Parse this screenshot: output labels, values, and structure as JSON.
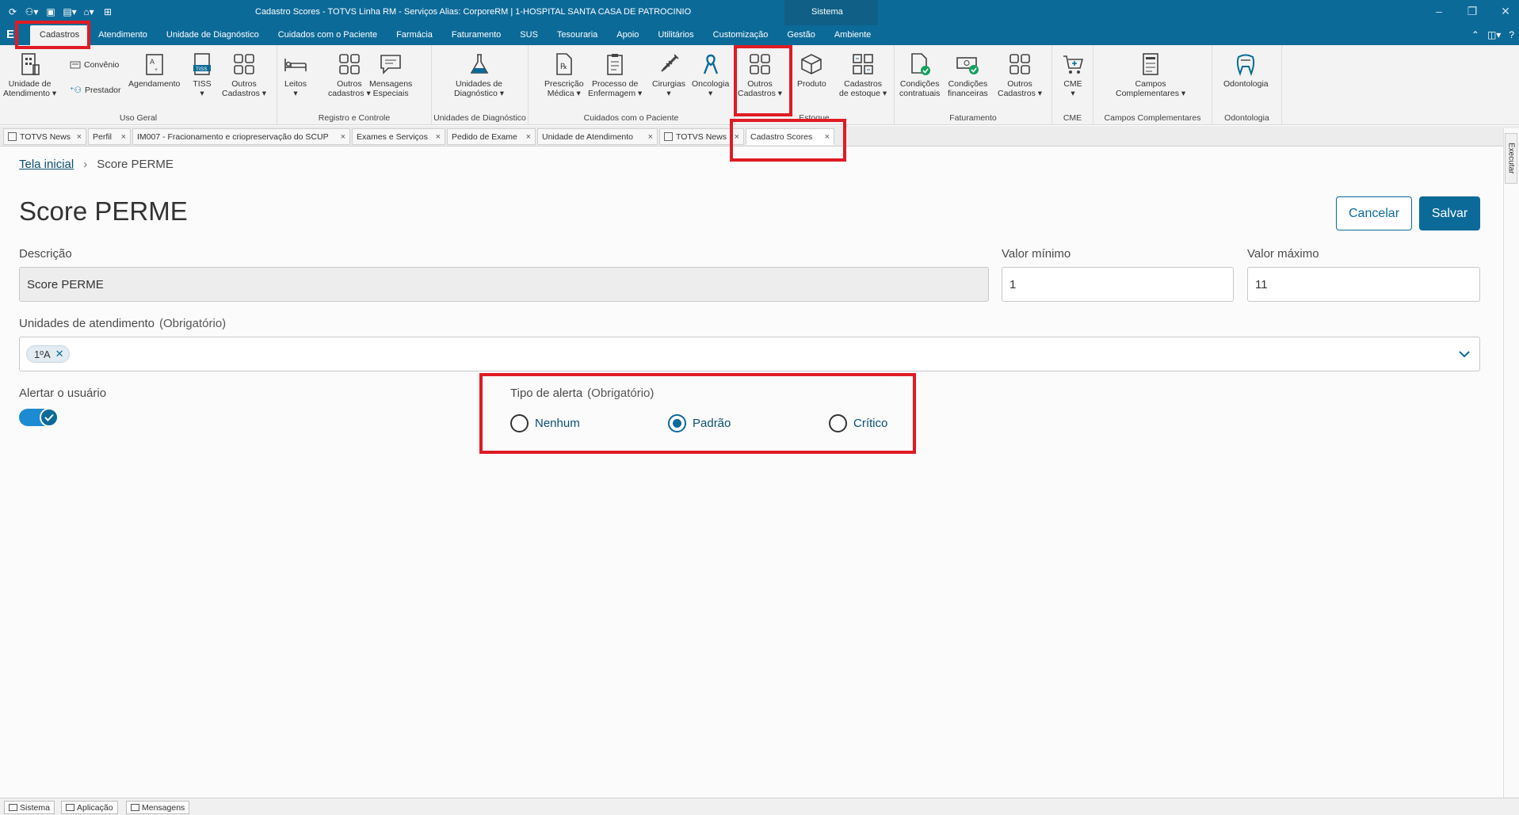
{
  "window": {
    "title": "Cadastro Scores - TOTVS Linha RM - Serviços  Alias: CorporeRM | 1-HOSPITAL SANTA CASA DE PATROCINIO",
    "sistema_tab": "Sistema"
  },
  "menu": {
    "logo": "E",
    "items": [
      "Cadastros",
      "Atendimento",
      "Unidade de Diagnóstico",
      "Cuidados com o Paciente",
      "Farmácia",
      "Faturamento",
      "SUS",
      "Tesouraria",
      "Apoio",
      "Utilitários",
      "Customização",
      "Gestão",
      "Ambiente"
    ],
    "active_index": 0
  },
  "ribbon": {
    "groups": {
      "uso_geral": "Uso Geral",
      "registro": "Registro e Controle",
      "unid_diag": "Unidades de Diagnóstico",
      "cuidados": "Cuidados com o Paciente",
      "estoque": "Estoque",
      "faturamento": "Faturamento",
      "cme": "CME",
      "campos": "Campos Complementares",
      "odonto": "Odontologia"
    },
    "buttons": {
      "unidade_atend_1": "Unidade de",
      "unidade_atend_2": "Atendimento",
      "convenio": "Convênio",
      "prestador": "Prestador",
      "agendamento": "Agendamento",
      "tiss": "TISS",
      "tiss_badge": "TISS",
      "outros_cad_1": "Outros",
      "outros_cad_2": "Cadastros",
      "leitos": "Leitos",
      "outros_cadastros_1": "Outros",
      "outros_cadastros_2": "cadastros",
      "mensagens_1": "Mensagens",
      "mensagens_2": "Especiais",
      "unidades_diag_1": "Unidades de",
      "unidades_diag_2": "Diagnóstico",
      "prescricao_1": "Prescrição",
      "prescricao_2": "Médica",
      "processo_1": "Processo de",
      "processo_2": "Enfermagem",
      "cirurgias": "Cirurgias",
      "oncologia": "Oncologia",
      "outros_cad3_1": "Outros",
      "outros_cad3_2": "Cadastros",
      "produto": "Produto",
      "cad_estoque_1": "Cadastros",
      "cad_estoque_2": "de estoque",
      "cond_contr_1": "Condições",
      "cond_contr_2": "contratuais",
      "cond_fin_1": "Condições",
      "cond_fin_2": "financeiras",
      "outros_cad4_1": "Outros",
      "outros_cad4_2": "Cadastros",
      "cme": "CME",
      "campos_1": "Campos",
      "campos_2": "Complementares",
      "odontologia": "Odontologia"
    }
  },
  "doc_tabs": [
    "TOTVS News",
    "Perfil",
    "IM007 - Fracionamento e criopreservação do SCUP",
    "Exames e Serviços",
    "Pedido de Exame",
    "Unidade de Atendimento",
    "TOTVS News",
    "Cadastro Scores"
  ],
  "side": {
    "executar": "Executar"
  },
  "breadcrumb": {
    "home": "Tela inicial",
    "current": "Score PERME"
  },
  "page": {
    "title": "Score PERME",
    "cancel": "Cancelar",
    "save": "Salvar"
  },
  "form": {
    "descricao_label": "Descrição",
    "descricao_value": "Score PERME",
    "valor_min_label": "Valor mínimo",
    "valor_min_value": "1",
    "valor_max_label": "Valor máximo",
    "valor_max_value": "11",
    "unidades_label": "Unidades de atendimento",
    "required": "(Obrigatório)",
    "unidade_chip": "1ºA",
    "alertar_label": "Alertar o usuário",
    "alertar_on": true,
    "tipo_label": "Tipo de alerta",
    "tipo_options": [
      "Nenhum",
      "Padrão",
      "Crítico"
    ],
    "tipo_selected": "Padrão"
  },
  "status_bar": [
    "Sistema",
    "Aplicação",
    "Mensagens"
  ],
  "colors": {
    "primary": "#0c6a99",
    "highlight": "#e01b24",
    "toggle": "#1d8bd1"
  }
}
